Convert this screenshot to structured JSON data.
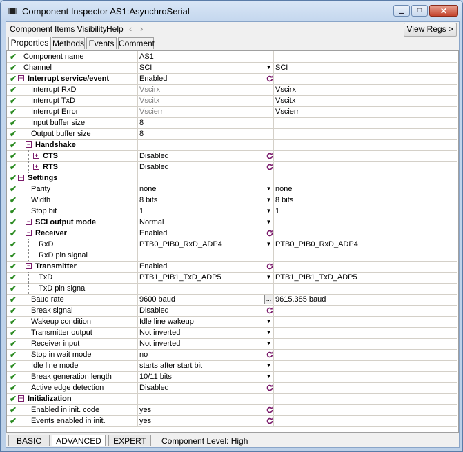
{
  "window": {
    "title": "Component Inspector AS1:AsynchroSerial"
  },
  "menu": [
    "Component",
    "Items Visibility",
    "Help"
  ],
  "toolbar": {
    "view_regs": "View Regs >"
  },
  "tabs": [
    "Properties",
    "Methods",
    "Events",
    "Comment"
  ],
  "rows": [
    {
      "indent": 0,
      "type": "prop",
      "name": "Component name",
      "value": "AS1",
      "ctrl": "",
      "info": ""
    },
    {
      "indent": 0,
      "type": "prop",
      "name": "Channel",
      "value": "SCI",
      "ctrl": "dropdown",
      "info": "SCI"
    },
    {
      "indent": 0,
      "type": "group",
      "expand": "minus",
      "name": "Interrupt service/event",
      "value": "Enabled",
      "ctrl": "reset",
      "info": ""
    },
    {
      "indent": 1,
      "type": "prop",
      "name": "Interrupt RxD",
      "value": "Vscirx",
      "gray": true,
      "ctrl": "",
      "info": "Vscirx"
    },
    {
      "indent": 1,
      "type": "prop",
      "name": "Interrupt TxD",
      "value": "Vscitx",
      "gray": true,
      "ctrl": "",
      "info": "Vscitx"
    },
    {
      "indent": 1,
      "type": "prop",
      "name": "Interrupt Error",
      "value": "Vscierr",
      "gray": true,
      "ctrl": "",
      "info": "Vscierr"
    },
    {
      "indent": 1,
      "type": "prop",
      "name": "Input buffer size",
      "value": "8",
      "ctrl": "",
      "info": ""
    },
    {
      "indent": 1,
      "type": "prop",
      "name": "Output buffer size",
      "value": "8",
      "ctrl": "",
      "info": ""
    },
    {
      "indent": 1,
      "type": "group",
      "expand": "minus",
      "name": "Handshake",
      "value": "",
      "ctrl": "",
      "info": ""
    },
    {
      "indent": 2,
      "type": "group",
      "expand": "plus",
      "name": "CTS",
      "value": "Disabled",
      "ctrl": "reset",
      "info": ""
    },
    {
      "indent": 2,
      "type": "group",
      "expand": "plus",
      "name": "RTS",
      "value": "Disabled",
      "ctrl": "reset",
      "info": ""
    },
    {
      "indent": 0,
      "type": "group",
      "expand": "minus",
      "name": "Settings",
      "value": "",
      "ctrl": "",
      "info": ""
    },
    {
      "indent": 1,
      "type": "prop",
      "name": "Parity",
      "value": "none",
      "ctrl": "dropdown",
      "info": "none"
    },
    {
      "indent": 1,
      "type": "prop",
      "name": "Width",
      "value": "8 bits",
      "ctrl": "dropdown",
      "info": "8 bits"
    },
    {
      "indent": 1,
      "type": "prop",
      "name": "Stop bit",
      "value": "1",
      "ctrl": "dropdown",
      "info": "1"
    },
    {
      "indent": 1,
      "type": "group",
      "expand": "minus",
      "name": "SCI output mode",
      "value": "Normal",
      "ctrl": "dropdown",
      "info": ""
    },
    {
      "indent": 1,
      "type": "group",
      "expand": "minus",
      "name": "Receiver",
      "value": "Enabled",
      "ctrl": "reset",
      "info": ""
    },
    {
      "indent": 2,
      "type": "prop",
      "name": "RxD",
      "value": "PTB0_PIB0_RxD_ADP4",
      "ctrl": "dropdown",
      "info": "PTB0_PIB0_RxD_ADP4"
    },
    {
      "indent": 2,
      "type": "prop",
      "name": "RxD pin signal",
      "value": "",
      "ctrl": "",
      "info": ""
    },
    {
      "indent": 1,
      "type": "group",
      "expand": "minus",
      "name": "Transmitter",
      "value": "Enabled",
      "ctrl": "reset",
      "info": ""
    },
    {
      "indent": 2,
      "type": "prop",
      "name": "TxD",
      "value": "PTB1_PIB1_TxD_ADP5",
      "ctrl": "dropdown",
      "info": "PTB1_PIB1_TxD_ADP5"
    },
    {
      "indent": 2,
      "type": "prop",
      "name": "TxD pin signal",
      "value": "",
      "ctrl": "",
      "info": ""
    },
    {
      "indent": 1,
      "type": "prop",
      "name": "Baud rate",
      "value": "9600 baud",
      "ctrl": "dots",
      "info": "9615.385 baud"
    },
    {
      "indent": 1,
      "type": "prop",
      "name": "Break signal",
      "value": "Disabled",
      "ctrl": "reset",
      "info": ""
    },
    {
      "indent": 1,
      "type": "prop",
      "name": "Wakeup condition",
      "value": "Idle line wakeup",
      "ctrl": "dropdown",
      "info": ""
    },
    {
      "indent": 1,
      "type": "prop",
      "name": "Transmitter output",
      "value": "Not inverted",
      "ctrl": "dropdown",
      "info": ""
    },
    {
      "indent": 1,
      "type": "prop",
      "name": "Receiver input",
      "value": "Not inverted",
      "ctrl": "dropdown",
      "info": ""
    },
    {
      "indent": 1,
      "type": "prop",
      "name": "Stop in wait mode",
      "value": "no",
      "ctrl": "reset",
      "info": ""
    },
    {
      "indent": 1,
      "type": "prop",
      "name": "Idle line mode",
      "value": "starts after start bit",
      "ctrl": "dropdown",
      "info": ""
    },
    {
      "indent": 1,
      "type": "prop",
      "name": "Break generation length",
      "value": "10/11 bits",
      "ctrl": "dropdown",
      "info": ""
    },
    {
      "indent": 1,
      "type": "prop",
      "name": "Active edge detection",
      "value": "Disabled",
      "ctrl": "reset",
      "info": ""
    },
    {
      "indent": 0,
      "type": "group",
      "expand": "minus",
      "name": "Initialization",
      "value": "",
      "ctrl": "",
      "info": ""
    },
    {
      "indent": 1,
      "type": "prop",
      "name": "Enabled in init. code",
      "value": "yes",
      "ctrl": "reset",
      "info": ""
    },
    {
      "indent": 1,
      "type": "prop",
      "name": "Events enabled in init.",
      "value": "yes",
      "ctrl": "reset",
      "info": ""
    }
  ],
  "bottom_tabs": [
    "BASIC",
    "ADVANCED",
    "EXPERT"
  ],
  "component_level": "Component Level: High"
}
